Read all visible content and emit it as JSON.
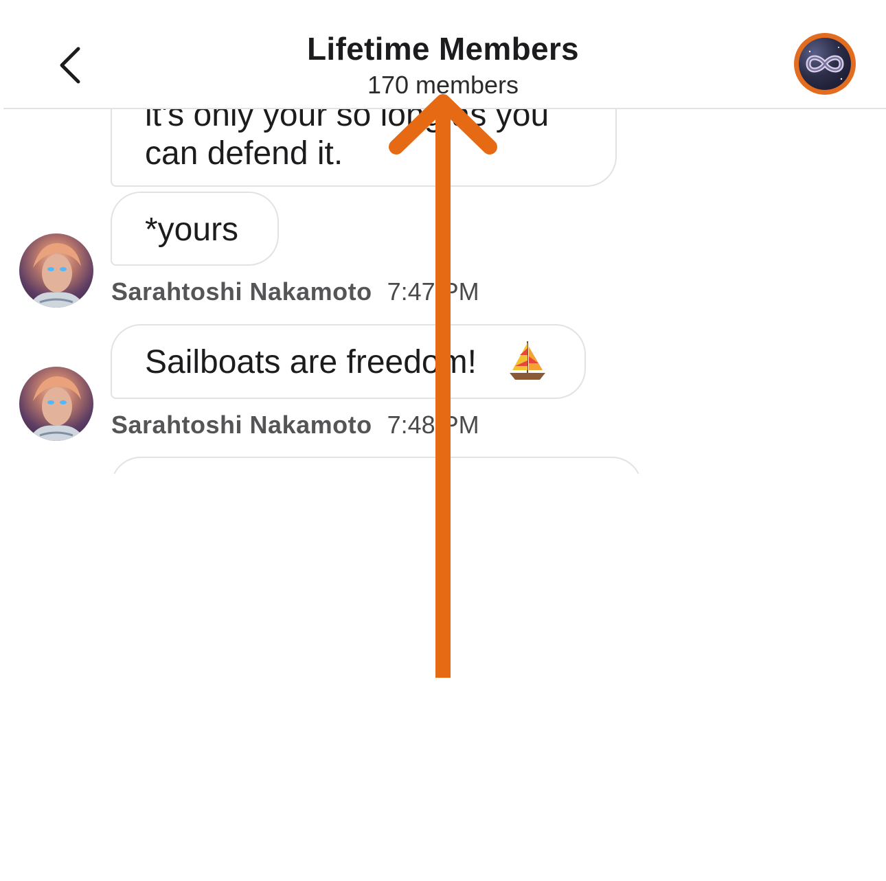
{
  "header": {
    "back_icon": "chevron-left-icon",
    "title": "Lifetime Members",
    "subtitle": "170 members",
    "group_avatar_icon": "infinity-logo-icon",
    "accent_color": "#e26c1f"
  },
  "messages": [
    {
      "lines": [
        "it's only your so long as you",
        "can defend it."
      ]
    },
    {
      "text": "*yours",
      "sender": "Sarahtoshi Nakamoto",
      "time": "7:47 PM"
    },
    {
      "text": "Sailboats are freedom!",
      "emoji": "sailboat-icon",
      "sender": "Sarahtoshi Nakamoto",
      "time": "7:48 PM"
    }
  ],
  "overlay": {
    "gesture": "swipe-up-arrow",
    "color": "#e66a14"
  }
}
